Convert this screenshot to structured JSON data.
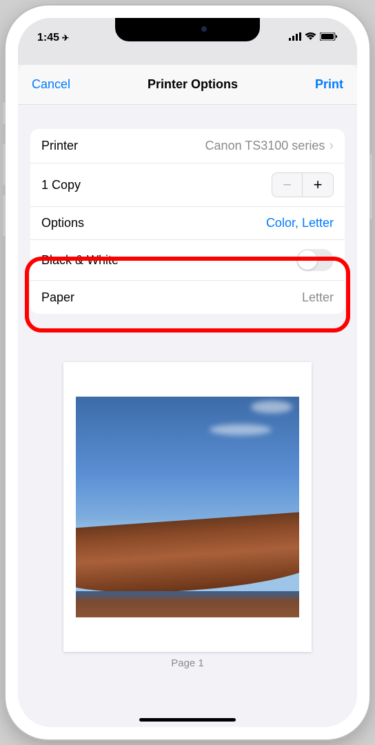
{
  "status": {
    "time": "1:45",
    "location_arrow": "➤"
  },
  "header": {
    "cancel": "Cancel",
    "title": "Printer Options",
    "print": "Print"
  },
  "rows": {
    "printer_label": "Printer",
    "printer_value": "Canon TS3100 series",
    "copies_label": "1 Copy",
    "options_label": "Options",
    "options_value": "Color, Letter",
    "bw_label": "Black & White",
    "paper_label": "Paper",
    "paper_value": "Letter"
  },
  "preview": {
    "page_label": "Page 1"
  }
}
